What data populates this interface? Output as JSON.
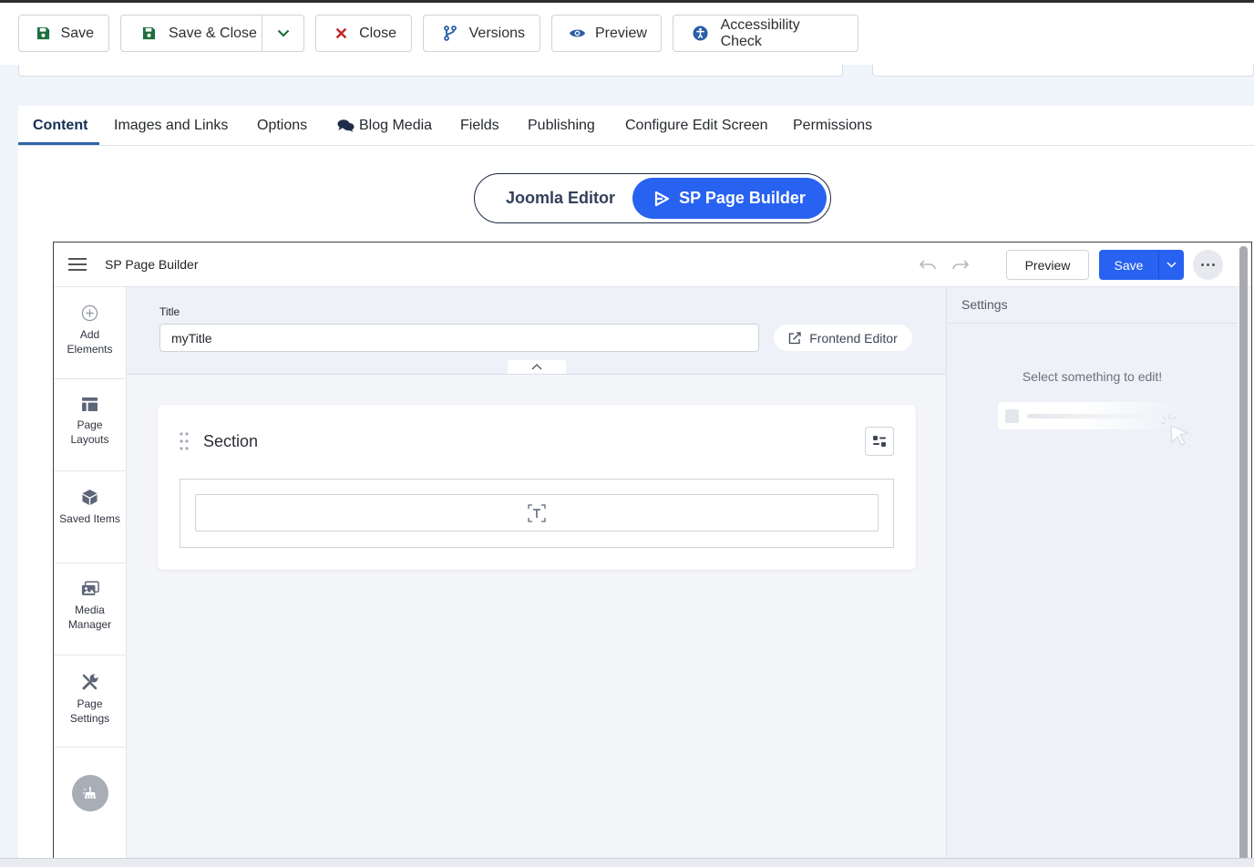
{
  "toolbar": {
    "save": "Save",
    "save_close": "Save & Close",
    "close": "Close",
    "versions": "Versions",
    "preview": "Preview",
    "accessibility": "Accessibility Check"
  },
  "tabs": [
    "Content",
    "Images and Links",
    "Options",
    "Blog Media",
    "Fields",
    "Publishing",
    "Configure Edit Screen",
    "Permissions"
  ],
  "editor_switch": {
    "joomla": "Joomla Editor",
    "sppb": "SP Page Builder"
  },
  "builder": {
    "app_title": "SP Page Builder",
    "preview": "Preview",
    "save": "Save",
    "sidebar": [
      {
        "label": "Add Elements",
        "icon": "plus-circle-icon"
      },
      {
        "label": "Page Layouts",
        "icon": "layout-icon"
      },
      {
        "label": "Saved Items",
        "icon": "cube-icon"
      },
      {
        "label": "Media Manager",
        "icon": "images-icon"
      },
      {
        "label": "Page Settings",
        "icon": "wrench-icon"
      }
    ],
    "title_label": "Title",
    "title_value": "myTitle",
    "frontend_editor": "Frontend Editor",
    "section_label": "Section",
    "settings_heading": "Settings",
    "settings_empty": "Select something to edit!"
  },
  "colors": {
    "accent": "#2862f1",
    "save_green": "#1e6f3e",
    "close_red": "#c52827",
    "link_blue": "#2a5ea8",
    "tab_underline": "#2e64a8"
  }
}
